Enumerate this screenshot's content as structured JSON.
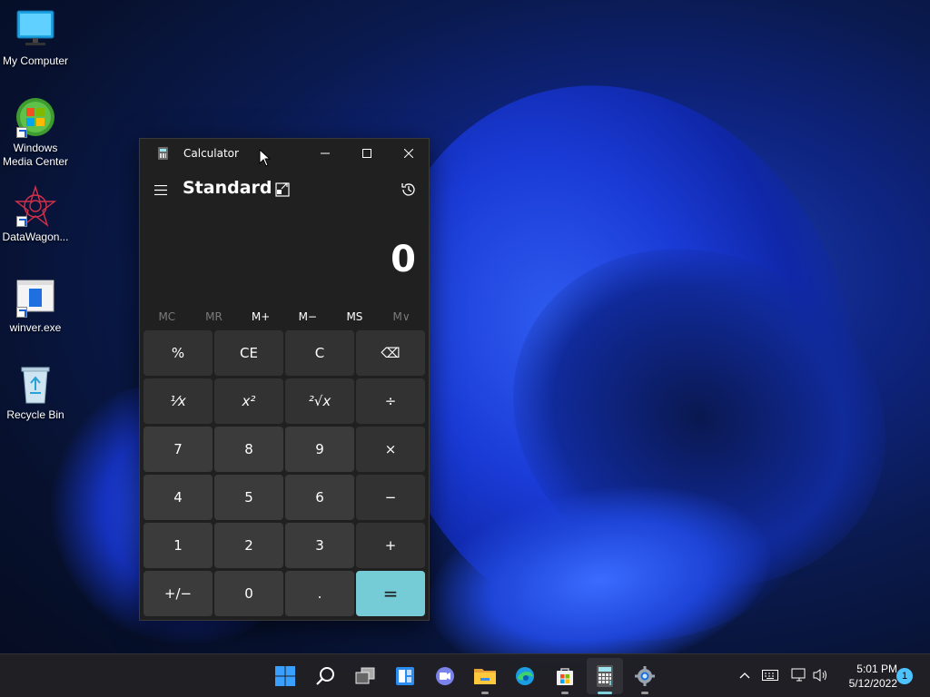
{
  "desktop": {
    "icons": [
      {
        "label": "My Computer",
        "icon": "monitor-icon"
      },
      {
        "label": "Windows Media Center",
        "icon": "windows-media-center-icon"
      },
      {
        "label": "DataWagon...",
        "icon": "datawagon-icon"
      },
      {
        "label": "winver.exe",
        "icon": "winver-icon"
      },
      {
        "label": "Recycle Bin",
        "icon": "recycle-bin-icon"
      }
    ]
  },
  "calculator": {
    "title": "Calculator",
    "mode": "Standard",
    "display": "0",
    "memory": {
      "buttons": [
        "MC",
        "MR",
        "M+",
        "M−",
        "MS",
        "M∨"
      ],
      "disabled": [
        "MC",
        "MR",
        "M∨"
      ]
    },
    "keys": [
      [
        "%",
        "CE",
        "C",
        "⌫"
      ],
      [
        "⅟x",
        "x²",
        "²√x",
        "÷"
      ],
      [
        "7",
        "8",
        "9",
        "×"
      ],
      [
        "4",
        "5",
        "6",
        "−"
      ],
      [
        "1",
        "2",
        "3",
        "+"
      ],
      [
        "+/−",
        "0",
        ".",
        "="
      ]
    ],
    "accent_color": "#76ccd6"
  },
  "taskbar": {
    "apps": [
      {
        "name": "start",
        "icon": "windows-logo-icon"
      },
      {
        "name": "search",
        "icon": "search-icon"
      },
      {
        "name": "task-view",
        "icon": "task-view-icon"
      },
      {
        "name": "widgets",
        "icon": "widgets-icon"
      },
      {
        "name": "teams-chat",
        "icon": "chat-icon"
      },
      {
        "name": "file-explorer",
        "icon": "folder-icon"
      },
      {
        "name": "edge",
        "icon": "edge-icon"
      },
      {
        "name": "store",
        "icon": "store-icon"
      },
      {
        "name": "calculator",
        "icon": "calculator-icon"
      },
      {
        "name": "settings",
        "icon": "gear-icon"
      }
    ],
    "clock": {
      "time": "5:01 PM",
      "date": "5/12/2022"
    },
    "notification_count": "1"
  }
}
